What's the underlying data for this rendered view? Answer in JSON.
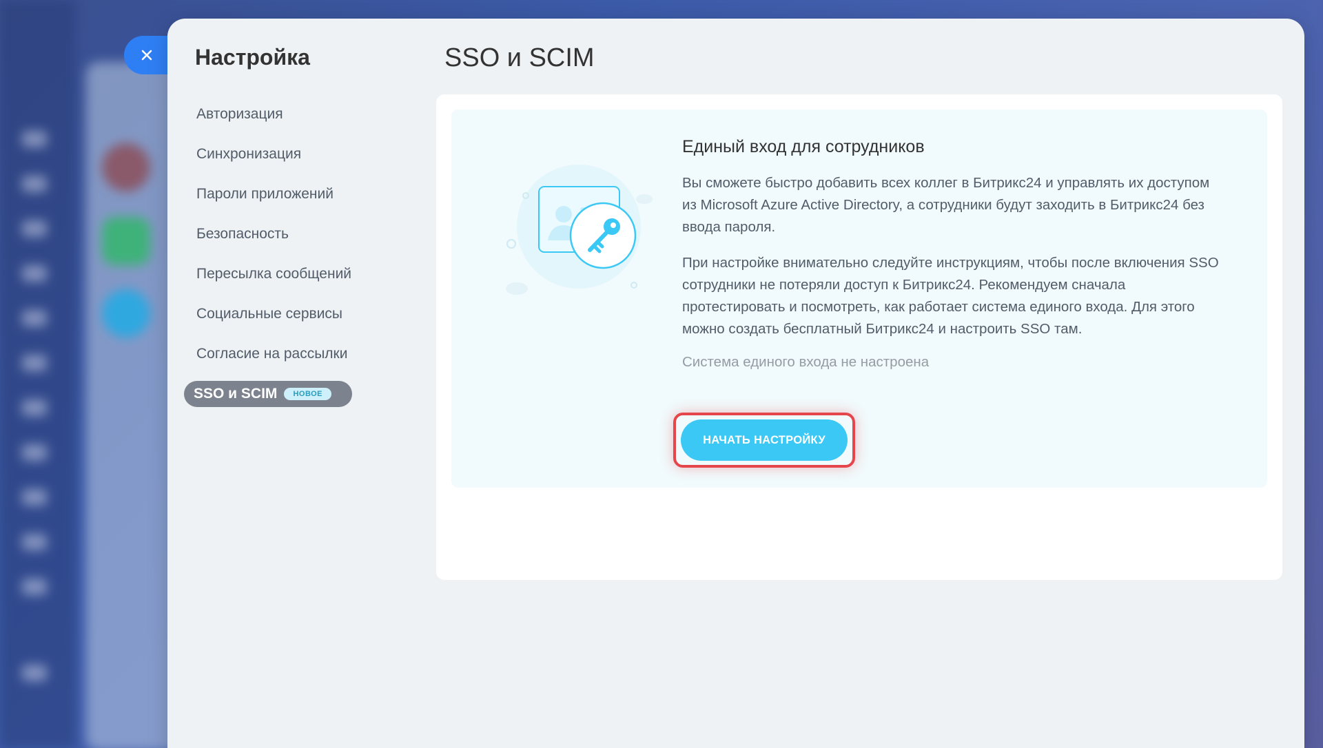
{
  "sidebar": {
    "title": "Настройка",
    "items": [
      {
        "label": "Авторизация"
      },
      {
        "label": "Синхронизация"
      },
      {
        "label": "Пароли приложений"
      },
      {
        "label": "Безопасность"
      },
      {
        "label": "Пересылка сообщений"
      },
      {
        "label": "Социальные сервисы"
      },
      {
        "label": "Согласие на рассылки"
      },
      {
        "label": "SSO и SCIM",
        "badge": "НОВОЕ",
        "active": true
      }
    ]
  },
  "page": {
    "title": "SSO и SCIM"
  },
  "card": {
    "heading": "Единый вход для сотрудников",
    "paragraph1": "Вы сможете быстро добавить всех коллег в Битрикс24 и управлять их доступом из Microsoft Azure Active Directory, а сотрудники будут заходить в Битрикс24 без ввода пароля.",
    "paragraph2": "При настройке внимательно следуйте инструкциям, чтобы после включения SSO сотрудники не потеряли доступ к Битрикс24. Рекомендуем сначала протестировать и посмотреть, как работает система единого входа. Для этого можно создать бесплатный Битрикс24 и настроить SSO там.",
    "status": "Система единого входа не настроена",
    "button_label": "НАЧАТЬ НАСТРОЙКУ"
  },
  "icons": {
    "close": "close-icon",
    "illustration": "user-card-key-illustration"
  },
  "colors": {
    "accent": "#3bc8f5",
    "close_tab": "#2f7ff4",
    "highlight": "#e5464b",
    "active_menu": "#7c838e"
  }
}
